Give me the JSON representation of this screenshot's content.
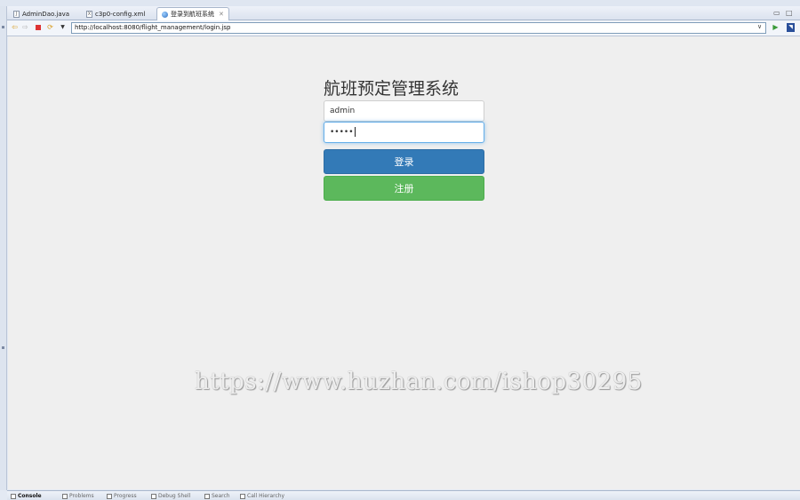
{
  "editor_tabs": [
    {
      "label": "AdminDao.java",
      "icon": "java-file-icon"
    },
    {
      "label": "c3p0-config.xml",
      "icon": "xml-file-icon"
    },
    {
      "label": "登录到航班系统",
      "icon": "globe-icon",
      "close": "✕",
      "active": true
    }
  ],
  "browser": {
    "url": "http://localhost:8080/flight_management/login.jsp"
  },
  "login": {
    "title": "航班预定管理系统",
    "username_value": "admin",
    "password_value": "•••••",
    "login_button": "登录",
    "register_button": "注册"
  },
  "watermark": "https://www.huzhan.com/ishop30295",
  "bottom_tabs": [
    {
      "label": "Console",
      "active": true
    },
    {
      "label": "Problems"
    },
    {
      "label": "Progress"
    },
    {
      "label": "Debug Shell"
    },
    {
      "label": "Search"
    },
    {
      "label": "Call Hierarchy"
    }
  ],
  "colors": {
    "primary": "#337ab7",
    "success": "#5cb85c",
    "page_bg": "#efefef"
  }
}
